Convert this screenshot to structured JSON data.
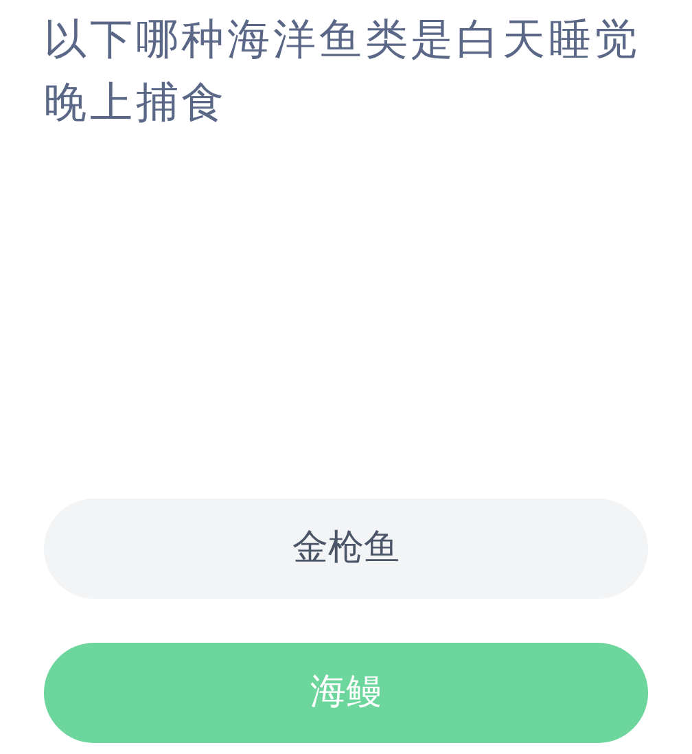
{
  "question": "以下哪种海洋鱼类是白天睡觉晚上捕食",
  "options": [
    {
      "label": "金枪鱼",
      "selected": false
    },
    {
      "label": "海鳗",
      "selected": true
    }
  ]
}
